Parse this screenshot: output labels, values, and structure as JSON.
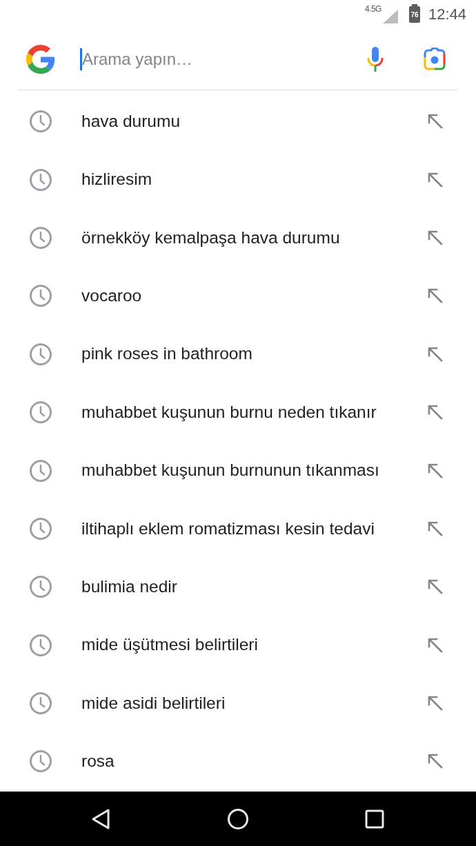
{
  "status_bar": {
    "network": "4.5G",
    "battery": "76",
    "time": "12:44"
  },
  "search": {
    "placeholder": "Arama yapın…",
    "focused": true
  },
  "history": [
    {
      "text": "hava durumu"
    },
    {
      "text": "hizliresim"
    },
    {
      "text": "örnekköy kemalpaşa hava durumu"
    },
    {
      "text": "vocaroo"
    },
    {
      "text": "pink roses in bathroom"
    },
    {
      "text": "muhabbet kuşunun burnu neden tıkanır"
    },
    {
      "text": "muhabbet kuşunun burnunun tıkanması"
    },
    {
      "text": "iltihaplı eklem romatizması kesin tedavi"
    },
    {
      "text": "bulimia nedir"
    },
    {
      "text": "mide üşütmesi belirtileri"
    },
    {
      "text": "mide asidi belirtileri"
    },
    {
      "text": "rosa"
    }
  ]
}
